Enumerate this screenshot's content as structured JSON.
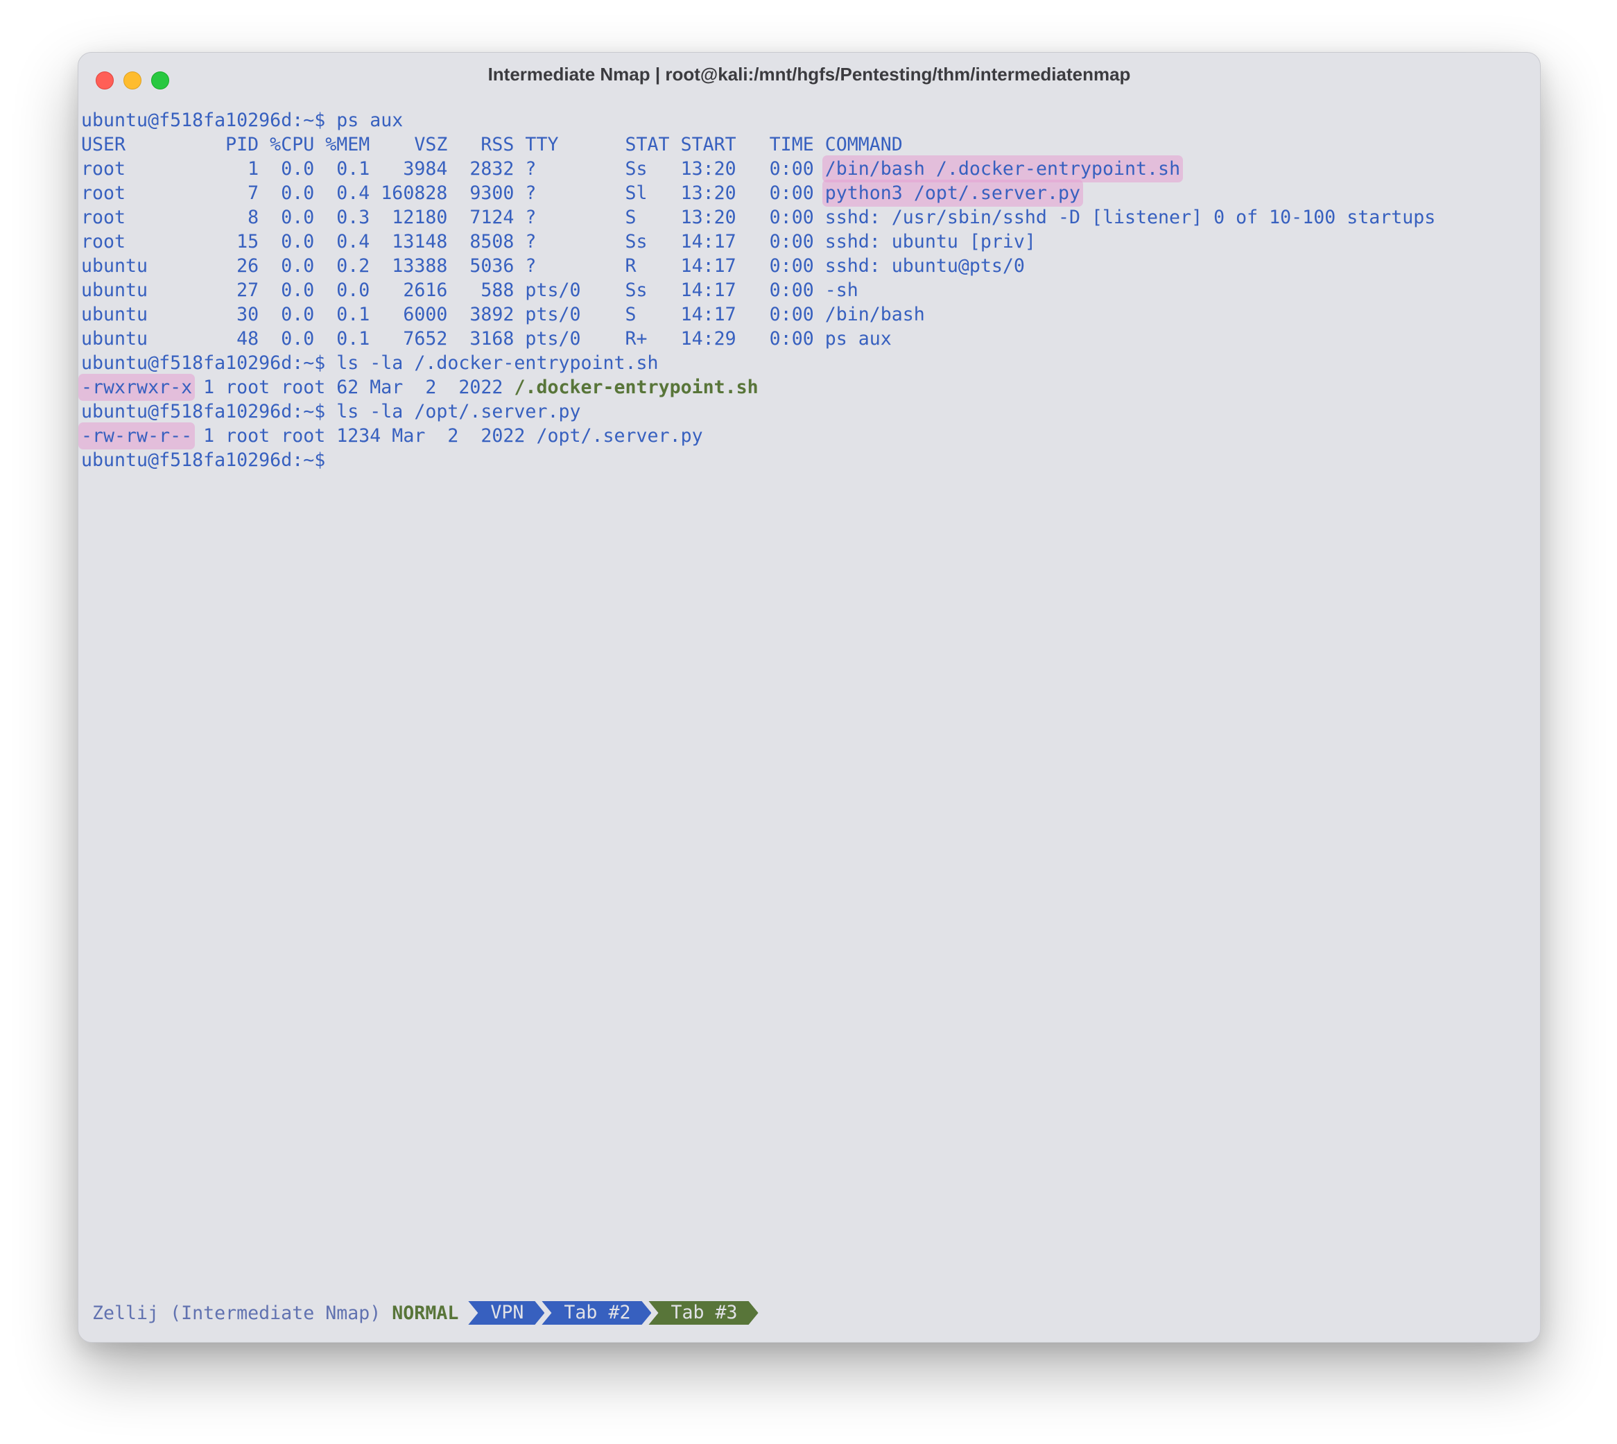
{
  "window": {
    "title": "Intermediate Nmap | root@kali:/mnt/hgfs/Pentesting/thm/intermediatenmap"
  },
  "terminal": {
    "lines": [
      {
        "pre": "ubuntu@f518fa10296d:~$ ps aux",
        "hl": "",
        "post": ""
      },
      {
        "pre": "USER         PID %CPU %MEM    VSZ   RSS TTY      STAT START   TIME COMMAND",
        "hl": "",
        "post": ""
      },
      {
        "pre": "root           1  0.0  0.1   3984  2832 ?        Ss   13:20   0:00 ",
        "hl": "/bin/bash /.docker-entrypoint.sh",
        "post": ""
      },
      {
        "pre": "root           7  0.0  0.4 160828  9300 ?        Sl   13:20   0:00 ",
        "hl": "python3 /opt/.server.py",
        "post": ""
      },
      {
        "pre": "root           8  0.0  0.3  12180  7124 ?        S    13:20   0:00 sshd: /usr/sbin/sshd -D [listener] 0 of 10-100 startups",
        "hl": "",
        "post": ""
      },
      {
        "pre": "root          15  0.0  0.4  13148  8508 ?        Ss   14:17   0:00 sshd: ubuntu [priv]",
        "hl": "",
        "post": ""
      },
      {
        "pre": "ubuntu        26  0.0  0.2  13388  5036 ?        R    14:17   0:00 sshd: ubuntu@pts/0",
        "hl": "",
        "post": ""
      },
      {
        "pre": "ubuntu        27  0.0  0.0   2616   588 pts/0    Ss   14:17   0:00 -sh",
        "hl": "",
        "post": ""
      },
      {
        "pre": "ubuntu        30  0.0  0.1   6000  3892 pts/0    S    14:17   0:00 /bin/bash",
        "hl": "",
        "post": ""
      },
      {
        "pre": "ubuntu        48  0.0  0.1   7652  3168 pts/0    R+   14:29   0:00 ps aux",
        "hl": "",
        "post": ""
      },
      {
        "pre": "ubuntu@f518fa10296d:~$ ls -la /.docker-entrypoint.sh",
        "hl": "",
        "post": ""
      },
      {
        "pre": "",
        "hl": "-rwxrwxr-x",
        "post": " 1 root root 62 Mar  2  2022 ",
        "green": "/.docker-entrypoint.sh"
      },
      {
        "pre": "ubuntu@f518fa10296d:~$ ls -la /opt/.server.py",
        "hl": "",
        "post": ""
      },
      {
        "pre": "",
        "hl": "-rw-rw-r--",
        "post": " 1 root root 1234 Mar  2  2022 /opt/.server.py"
      },
      {
        "pre": "ubuntu@f518fa10296d:~$ ",
        "hl": "",
        "post": ""
      }
    ]
  },
  "statusbar": {
    "session": "Zellij (Intermediate Nmap)",
    "mode": "NORMAL",
    "tabs": [
      {
        "label": "VPN",
        "color": "#3760bf"
      },
      {
        "label": "Tab #2",
        "color": "#3760bf"
      },
      {
        "label": "Tab #3",
        "color": "#587539"
      }
    ]
  },
  "colors": {
    "text": "#3760bf",
    "background": "#e1e2e7",
    "highlight": "#e6a0d2",
    "green": "#587539"
  }
}
